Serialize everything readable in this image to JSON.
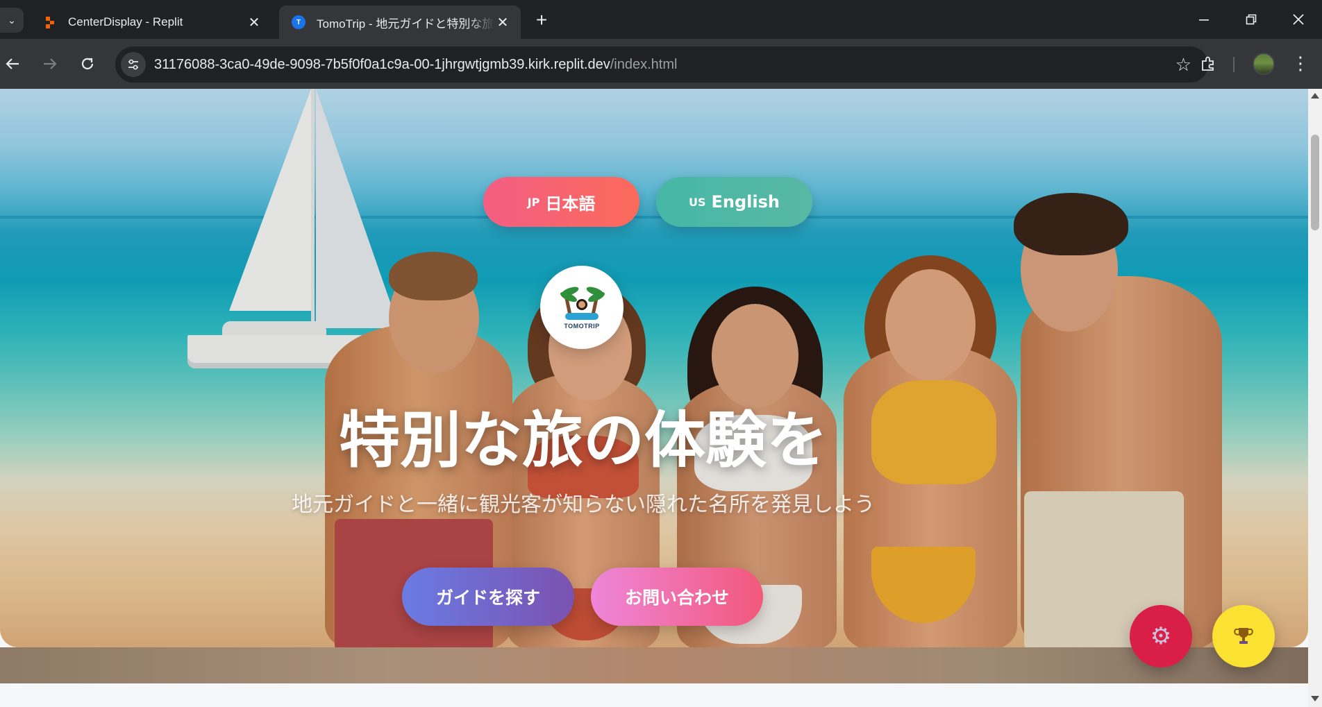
{
  "browser": {
    "tabs": [
      {
        "title": "CenterDisplay - Replit",
        "icon": "replit-icon",
        "active": false
      },
      {
        "title": "TomoTrip - 地元ガイドと特別な旅の体験",
        "icon": "tomotrip-favicon",
        "active": true
      }
    ],
    "url_host": "31176088-3ca0-49de-9098-7b5f0f0a1c9a-00-1jhrgwtjgmb39.kirk.replit.dev",
    "url_path": "/index.html"
  },
  "hero": {
    "lang_ja_flag": "JP",
    "lang_ja_label": "日本語",
    "lang_en_flag": "US",
    "lang_en_label": "English",
    "logo_text": "TOMOTRIP",
    "title": "特別な旅の体験を",
    "subtitle": "地元ガイドと一緒に観光客が知らない隠れた名所を発見しよう",
    "cta_guide": "ガイドを探す",
    "cta_contact": "お問い合わせ"
  },
  "floating": {
    "settings_icon": "gear-icon",
    "trophy_icon": "trophy-icon"
  },
  "colors": {
    "lang_ja": "#f35e83",
    "lang_en": "#46b7a6",
    "cta_guide": "#6a7be3",
    "cta_contact": "#f3587b",
    "fab_settings": "#d91f47",
    "fab_trophy": "#fbe132"
  }
}
